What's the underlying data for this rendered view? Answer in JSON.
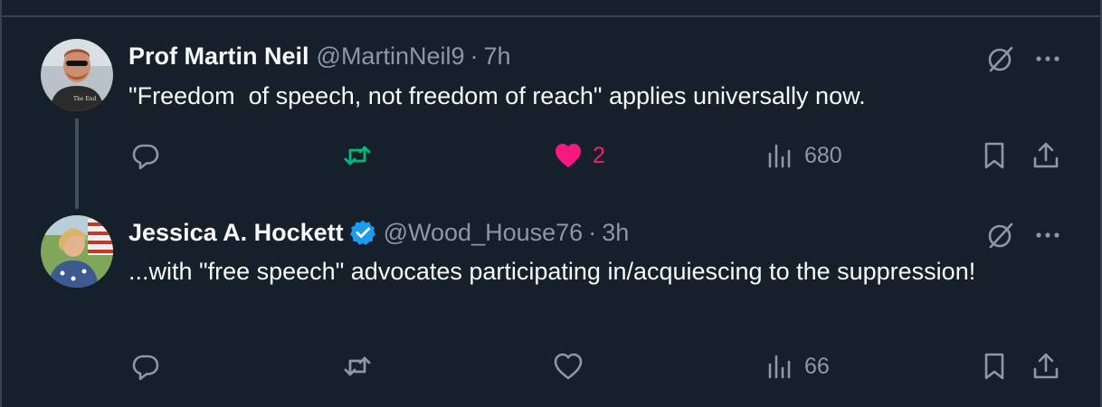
{
  "tweets": [
    {
      "display_name": "Prof Martin Neil",
      "handle": "@MartinNeil9",
      "separator": "·",
      "time": "7h",
      "text": "\"Freedom  of speech, not freedom of reach\" applies universally now.",
      "verified": false,
      "reply_count": "",
      "retweet_count": "",
      "like_count": "2",
      "view_count": "680",
      "retweeted": true,
      "liked": true
    },
    {
      "display_name": "Jessica A. Hockett",
      "handle": "@Wood_House76",
      "separator": "·",
      "time": "3h",
      "text": "...with \"free speech\" advocates participating in/acquiescing to the suppression!",
      "verified": true,
      "reply_count": "",
      "retweet_count": "",
      "like_count": "",
      "view_count": "66",
      "retweeted": false,
      "liked": false
    }
  ],
  "icons": {
    "reply": "reply-icon",
    "retweet": "retweet-icon",
    "like": "heart-icon",
    "views": "views-icon",
    "bookmark": "bookmark-icon",
    "share": "share-icon",
    "grok": "grok-icon",
    "more": "more-icon",
    "verified": "verified-badge-icon"
  },
  "colors": {
    "background": "#15202b",
    "text": "#f7f9f9",
    "muted": "#8b98a5",
    "retweet_active": "#00ba7c",
    "like_active": "#f91880",
    "verified": "#1d9bf0",
    "border": "#38444d"
  }
}
